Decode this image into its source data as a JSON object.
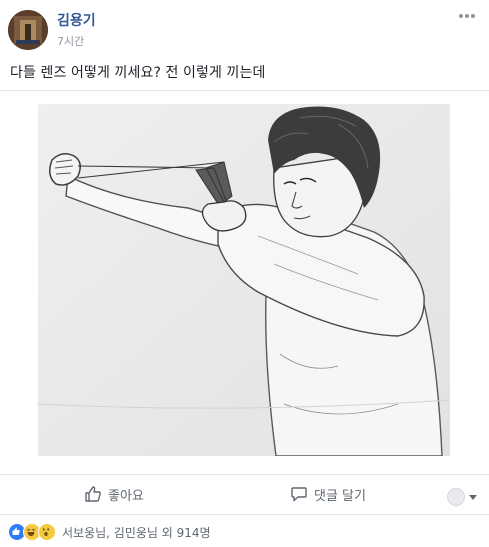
{
  "post": {
    "author": "김용기",
    "time": "7시간",
    "text": "다들 렌즈 어떻게 끼세요? 전 이렇게 끼는데"
  },
  "actions": {
    "like_label": "좋아요",
    "comment_label": "댓글 달기"
  },
  "reactions": {
    "summary": "서보웅님, 김민웅님 외 914명"
  },
  "icons": [
    "more-dots-icon",
    "thumbs-up-icon",
    "comment-bubble-icon",
    "like-reaction-icon",
    "haha-reaction-icon",
    "wow-reaction-icon",
    "caret-down-icon"
  ],
  "colors": {
    "author": "#365899",
    "meta": "#90949c",
    "like_blue": "#2e7cf6",
    "emoji_yellow": "#f7c941"
  }
}
